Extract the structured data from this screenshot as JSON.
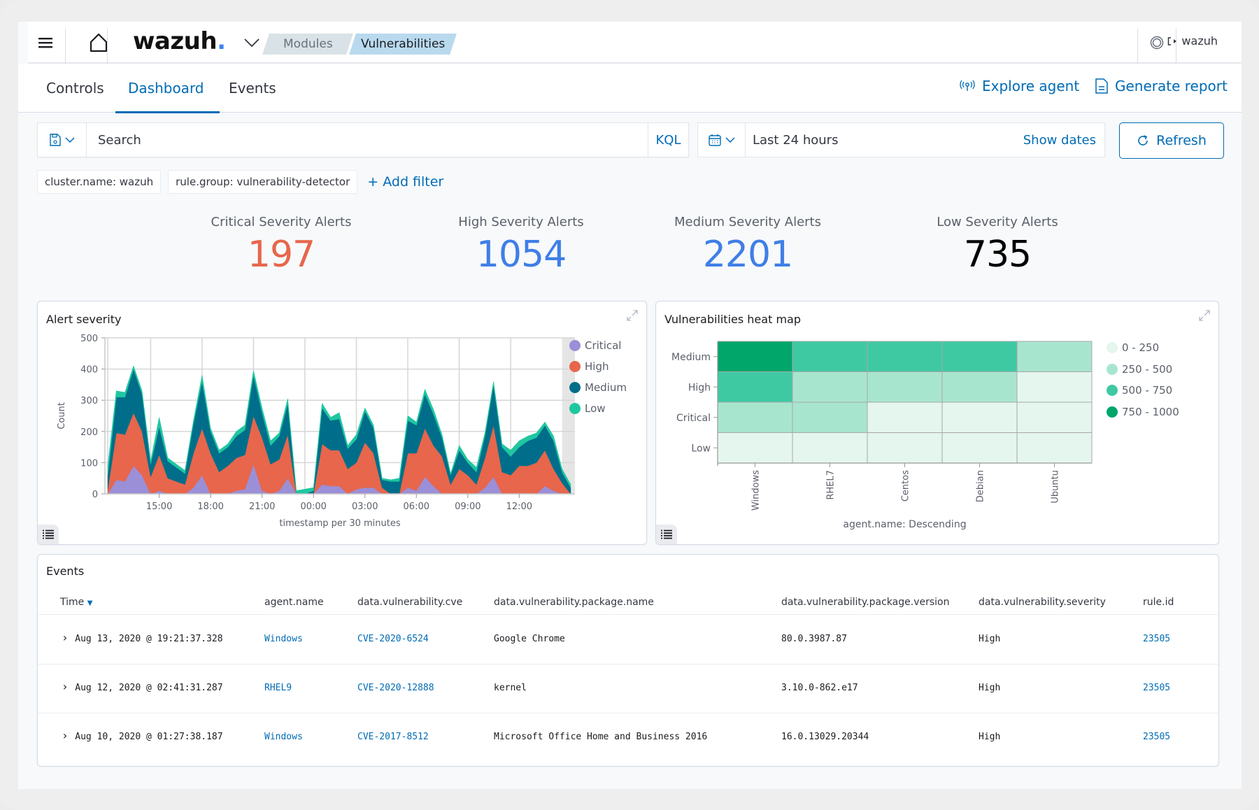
{
  "nav": {
    "brand": "wazuh",
    "brand_dot": ".",
    "breadcrumbs": [
      "Modules",
      "Vulnerabilities"
    ],
    "user": "wazuh",
    "icons": {
      "menu": "hamburger-icon",
      "home": "home-icon",
      "brand_menu": "chevron-down-icon",
      "health": "ring-icon",
      "logout": "logout-icon"
    }
  },
  "tabs": {
    "items": [
      "Controls",
      "Dashboard",
      "Events"
    ],
    "active": "Dashboard",
    "explore_agent": "Explore agent",
    "generate_report": "Generate report"
  },
  "search": {
    "placeholder": "Search",
    "language": "KQL",
    "time_range": "Last 24 hours",
    "show_dates": "Show dates",
    "refresh": "Refresh"
  },
  "filters": {
    "pills": [
      "cluster.name: wazuh",
      "rule.group: vulnerability-detector"
    ],
    "add_label": "+ Add filter"
  },
  "metrics": [
    {
      "label": "Critical Severity Alerts",
      "value": "197",
      "color": "#e7664c"
    },
    {
      "label": "High Severity Alerts",
      "value": "1054",
      "color": "#3f7fe6"
    },
    {
      "label": "Medium Severity Alerts",
      "value": "2201",
      "color": "#3f7fe6"
    },
    {
      "label": "Low Severity Alerts",
      "value": "735",
      "color": "#000000"
    }
  ],
  "chart_data": [
    {
      "type": "area",
      "title": "Alert severity",
      "stacked": true,
      "xlabel": "timestamp per 30 minutes",
      "ylabel": "Count",
      "ylim": [
        0,
        500
      ],
      "yticks": [
        0,
        100,
        200,
        300,
        400,
        500
      ],
      "xticks": [
        "15:00",
        "18:00",
        "21:00",
        "00:00",
        "03:00",
        "06:00",
        "09:00",
        "12:00"
      ],
      "grid": true,
      "legend": "right",
      "x": [
        "12:00",
        "12:30",
        "13:00",
        "13:30",
        "14:00",
        "14:30",
        "15:00",
        "15:30",
        "16:00",
        "16:30",
        "17:00",
        "17:30",
        "18:00",
        "18:30",
        "19:00",
        "19:30",
        "20:00",
        "20:30",
        "21:00",
        "21:30",
        "22:00",
        "22:30",
        "23:00",
        "23:30",
        "00:00",
        "00:30",
        "01:00",
        "01:30",
        "02:00",
        "02:30",
        "03:00",
        "03:30",
        "04:00",
        "04:30",
        "05:00",
        "05:30",
        "06:00",
        "06:30",
        "07:00",
        "07:30",
        "08:00",
        "08:30",
        "09:00",
        "09:30",
        "10:00",
        "10:30",
        "11:00",
        "11:30",
        "12:00",
        "12:30",
        "13:00",
        "13:30",
        "14:00",
        "14:30",
        "15:00"
      ],
      "series": [
        {
          "name": "Critical",
          "color": "#9b8fd8",
          "values": [
            0,
            45,
            40,
            90,
            60,
            0,
            10,
            0,
            0,
            0,
            20,
            60,
            0,
            0,
            0,
            10,
            15,
            95,
            10,
            0,
            10,
            50,
            0,
            0,
            0,
            30,
            25,
            25,
            0,
            15,
            20,
            20,
            0,
            0,
            0,
            20,
            10,
            55,
            25,
            0,
            0,
            0,
            0,
            0,
            20,
            55,
            0,
            0,
            0,
            0,
            0,
            25,
            10,
            0,
            0
          ]
        },
        {
          "name": "High",
          "color": "#e7664c",
          "values": [
            15,
            150,
            150,
            170,
            140,
            55,
            115,
            50,
            40,
            30,
            110,
            150,
            130,
            70,
            90,
            105,
            110,
            155,
            170,
            95,
            100,
            140,
            0,
            0,
            0,
            130,
            115,
            115,
            80,
            85,
            145,
            110,
            20,
            0,
            0,
            110,
            120,
            155,
            130,
            120,
            30,
            80,
            60,
            30,
            95,
            165,
            70,
            60,
            90,
            90,
            100,
            115,
            70,
            35,
            0
          ]
        },
        {
          "name": "Medium",
          "color": "#006e8a",
          "values": [
            45,
            115,
            120,
            140,
            120,
            40,
            90,
            55,
            45,
            35,
            95,
            150,
            70,
            60,
            60,
            70,
            80,
            130,
            80,
            60,
            75,
            100,
            0,
            0,
            10,
            115,
            95,
            100,
            65,
            75,
            100,
            80,
            25,
            40,
            40,
            105,
            90,
            110,
            100,
            60,
            30,
            60,
            40,
            40,
            70,
            130,
            80,
            60,
            60,
            80,
            80,
            80,
            90,
            35,
            20
          ]
        },
        {
          "name": "Low",
          "color": "#1fc7a0",
          "values": [
            30,
            20,
            15,
            10,
            10,
            10,
            30,
            10,
            10,
            10,
            10,
            20,
            10,
            10,
            10,
            15,
            15,
            15,
            15,
            15,
            10,
            15,
            10,
            15,
            10,
            15,
            10,
            20,
            10,
            15,
            10,
            10,
            5,
            5,
            10,
            15,
            10,
            15,
            15,
            10,
            5,
            15,
            10,
            15,
            10,
            10,
            10,
            20,
            20,
            15,
            15,
            10,
            15,
            10,
            10
          ]
        }
      ]
    },
    {
      "type": "heatmap",
      "title": "Vulnerabilities heat map",
      "xlabel": "agent.name: Descending",
      "categories_x": [
        "Windows",
        "RHEL7",
        "Centos",
        "Debian",
        "Ubuntu"
      ],
      "categories_y": [
        "Medium",
        "High",
        "Critical",
        "Low"
      ],
      "legend": "right",
      "ranges": [
        {
          "label": "0 - 250",
          "color": "#e4f6ee"
        },
        {
          "label": "250 - 500",
          "color": "#a8e5cf"
        },
        {
          "label": "500 - 750",
          "color": "#3fc9a3"
        },
        {
          "label": "750 - 1000",
          "color": "#00a66a"
        }
      ],
      "cells": [
        [
          "750 - 1000",
          "500 - 750",
          "500 - 750",
          "500 - 750",
          "250 - 500"
        ],
        [
          "500 - 750",
          "250 - 500",
          "250 - 500",
          "250 - 500",
          "0 - 250"
        ],
        [
          "250 - 500",
          "250 - 500",
          "0 - 250",
          "0 - 250",
          "0 - 250"
        ],
        [
          "0 - 250",
          "0 - 250",
          "0 - 250",
          "0 - 250",
          "0 - 250"
        ]
      ]
    }
  ],
  "events": {
    "title": "Events",
    "columns": [
      "Time",
      "agent.name",
      "data.vulnerability.cve",
      "data.vulnerability.package.name",
      "data.vulnerability.package.version",
      "data.vulnerability.severity",
      "rule.id"
    ],
    "rows": [
      [
        "Aug 13, 2020 @ 19:21:37.328",
        "Windows",
        "CVE-2020-6524",
        "Google Chrome",
        "80.0.3987.87",
        "High",
        "23505"
      ],
      [
        "Aug 12, 2020 @ 02:41:31.287",
        "RHEL9",
        "CVE-2020-12888",
        "kernel",
        "3.10.0-862.e17",
        "High",
        "23505"
      ],
      [
        "Aug 10, 2020 @ 01:27:38.187",
        "Windows",
        "CVE-2017-8512",
        "Microsoft Office Home and Business 2016",
        "16.0.13029.20344",
        "High",
        "23505"
      ]
    ]
  }
}
